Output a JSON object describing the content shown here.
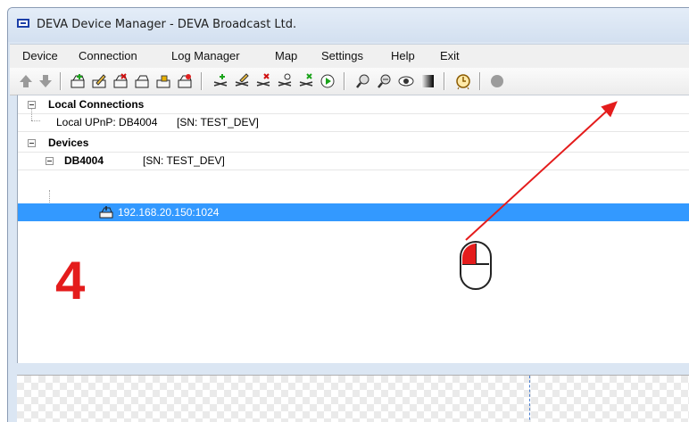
{
  "window": {
    "title": "DEVA Device Manager - DEVA Broadcast Ltd."
  },
  "menu": [
    "Device",
    "Connection",
    "Log Manager",
    "Map",
    "Settings",
    "Help",
    "Exit"
  ],
  "tree": {
    "local_connections": "Local Connections",
    "local_upnp": "Local UPnP: DB4004",
    "local_upnp_sn": "[SN: TEST_DEV]",
    "devices": "Devices",
    "device_name": "DB4004",
    "device_sn": "[SN: TEST_DEV]",
    "device_ip": "192.168.20.150:1024"
  },
  "annotation": {
    "step_number": "4"
  },
  "colors": {
    "accent": "#3399ff",
    "annotation": "#e41c1c"
  }
}
